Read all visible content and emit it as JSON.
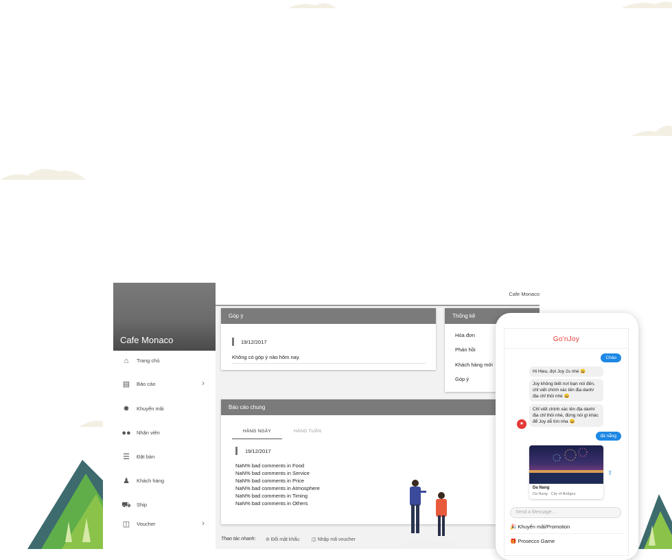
{
  "sidebar": {
    "title": "Cafe Monaco",
    "items": [
      {
        "label": "Trang chủ",
        "icon": "home-icon",
        "has_chevron": false
      },
      {
        "label": "Báo cáo",
        "icon": "report-icon",
        "has_chevron": true
      },
      {
        "label": "Khuyến mãi",
        "icon": "badge-icon",
        "has_chevron": false
      },
      {
        "label": "Nhân viên",
        "icon": "people-icon",
        "has_chevron": false
      },
      {
        "label": "Đặt bàn",
        "icon": "list-icon",
        "has_chevron": false
      },
      {
        "label": "Khách hàng",
        "icon": "user-icon",
        "has_chevron": false
      },
      {
        "label": "Ship",
        "icon": "truck-icon",
        "has_chevron": false
      },
      {
        "label": "Voucher",
        "icon": "gift-icon",
        "has_chevron": true
      }
    ]
  },
  "topbar": {
    "title": "Cafe Monaco"
  },
  "gopy": {
    "title": "Góp ý",
    "date": "19/12/2017",
    "message": "Không có góp ý nào hôm nay."
  },
  "thongke": {
    "title": "Thống kê",
    "items": [
      "Hóa đơn",
      "Phản hồi",
      "Khách hàng mới",
      "Góp ý"
    ]
  },
  "baocao": {
    "title": "Báo cáo chung",
    "tabs": [
      "HÀNG NGÀY",
      "HÀNG TUẦN"
    ],
    "active_tab": "HÀNG NGÀY",
    "date": "19/12/2017",
    "lines": [
      "NaN% bad comments in Food",
      "NaN% bad comments in Service",
      "NaN% bad comments in Price",
      "NaN% bad comments in Atmosphere",
      "NaN% bad comments in Timing",
      "NaN% bad comments in Others"
    ]
  },
  "quick_actions": {
    "label": "Thao tác nhanh:",
    "items": [
      "Đổi mật khẩu",
      "Nhập mã voucher"
    ]
  },
  "chat": {
    "brand": "Go'nJoy",
    "messages": [
      {
        "side": "right",
        "text": "Chào"
      },
      {
        "side": "left",
        "text": "Hi Hieu, đợi Joy 2s nhé 😄"
      },
      {
        "side": "left",
        "text": "Joy không biết nơi bạn nói đến, chỉ viết chính xác tên địa danh/ địa chỉ thôi nhé 😄"
      },
      {
        "side": "left",
        "text": "Chỉ viết chính xác tên địa danh/ địa chỉ thôi nhé, đừng nói gì khác để Joy dễ tìm nha 😄"
      },
      {
        "side": "right",
        "text": "đà nẵng"
      }
    ],
    "card": {
      "title": "Da Nang",
      "subtitle": "Da Nang - City of Bridges"
    },
    "input_placeholder": "Send a Message...",
    "menu": [
      "🎉 Khuyến mãi/Promotion",
      "🎁 Prosecco Game"
    ]
  },
  "colors": {
    "header_grey": "#7b7b7b",
    "brand_red": "#e53935",
    "chat_blue": "#1e88e5",
    "mountain_green": "#5fae4a"
  }
}
